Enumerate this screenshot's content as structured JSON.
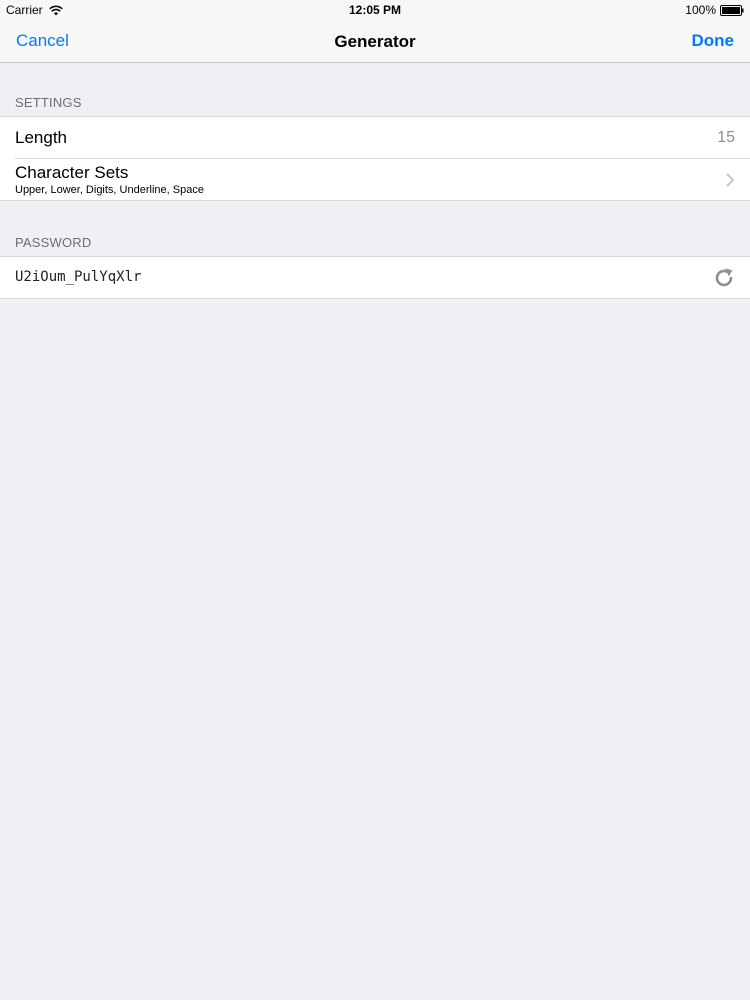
{
  "status_bar": {
    "carrier": "Carrier",
    "time": "12:05 PM",
    "battery": "100%"
  },
  "nav": {
    "cancel_label": "Cancel",
    "title": "Generator",
    "done_label": "Done"
  },
  "settings": {
    "header": "SETTINGS",
    "length_label": "Length",
    "length_value": "15",
    "charset_label": "Character Sets",
    "charset_value": "Upper, Lower, Digits, Underline, Space"
  },
  "password": {
    "header": "PASSWORD",
    "value": "U2iOum_PulYqXlr"
  },
  "colors": {
    "accent": "#007aff",
    "background": "#efeff4",
    "secondary_text": "#8e8e93"
  },
  "icons": {
    "wifi": "wifi-icon",
    "battery": "battery-icon",
    "chevron": "chevron-right-icon",
    "refresh": "refresh-icon"
  }
}
